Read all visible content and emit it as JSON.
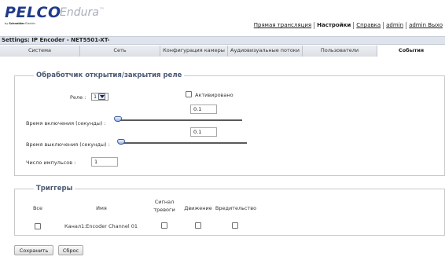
{
  "header": {
    "brand": "PELCO",
    "product": "Endura",
    "trademark": "™",
    "sub_prefix": "by ",
    "sub_company": "Schneider",
    "sub_suffix": " Electric",
    "nav": [
      {
        "label": "Прямая трансляция",
        "active": false
      },
      {
        "label": "Настройки",
        "active": true
      },
      {
        "label": "Справка",
        "active": false
      },
      {
        "label": "admin",
        "active": false
      },
      {
        "label": "admin Выхо",
        "active": false
      }
    ]
  },
  "settings_bar": {
    "text": "Settings: IP Encoder - NET5501-XT-"
  },
  "tabs": [
    {
      "label": "Система",
      "active": false
    },
    {
      "label": "Сеть",
      "active": false
    },
    {
      "label": "Конфигурация камеры",
      "active": false
    },
    {
      "label": "Аудиовизуальные потоки",
      "active": false
    },
    {
      "label": "Пользователи",
      "active": false
    },
    {
      "label": "События",
      "active": true
    }
  ],
  "relay_section": {
    "legend": "Обработчик открытия/закрытия реле",
    "relay_label": "Реле :",
    "relay_value": "1",
    "activated_label": "Активировано",
    "activated_checked": false,
    "on_time_label": "Время включения (секунды) :",
    "on_time_value": "0.1",
    "on_time_slider_fraction": 0,
    "off_time_label": "Время выключения (секунды) :",
    "off_time_value": "0.1",
    "off_time_slider_fraction": 0,
    "pulses_label": "Число импульсов :",
    "pulses_value": "1"
  },
  "triggers_section": {
    "legend": "Триггеры",
    "columns": {
      "all": "Все",
      "name": "Имя",
      "alarm_line1": "Сигнал",
      "alarm_line2": "тревоги",
      "motion": "Движение",
      "tamper": "Вредительство"
    },
    "rows": [
      {
        "name": "Канал1:Encoder Channel 01",
        "all": false,
        "alarm": false,
        "motion": false,
        "tamper": false
      }
    ]
  },
  "buttons": {
    "save": "Сохранить",
    "reset": "Сброс"
  },
  "colors": {
    "brand_blue": "#1f3a8a",
    "legend_color": "#4a5873",
    "bar_bg": "#dfe4ec"
  }
}
